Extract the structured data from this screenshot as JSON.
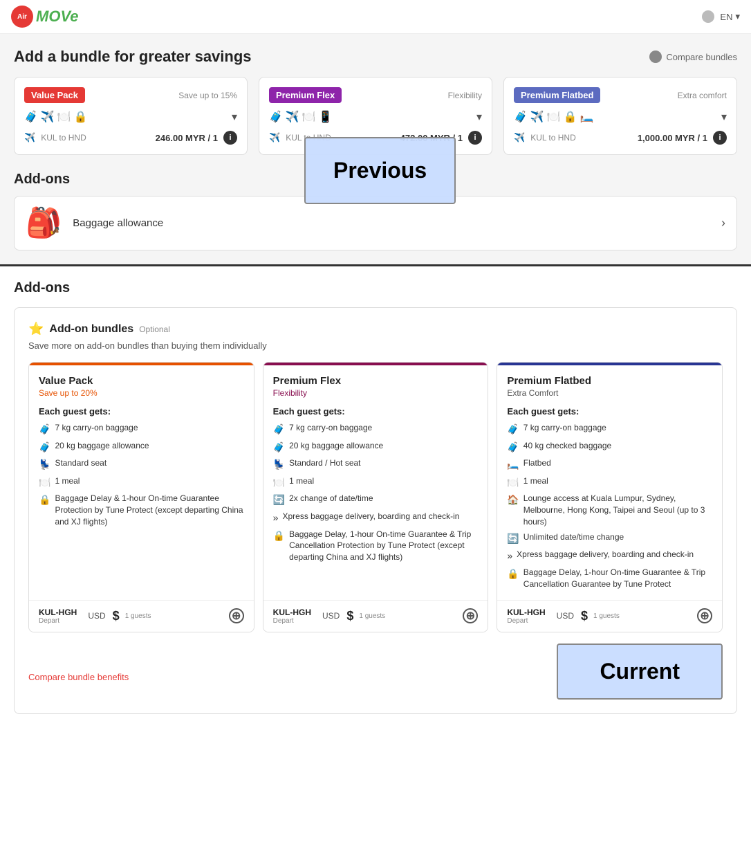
{
  "nav": {
    "logo_text": "MOVe",
    "logo_abbr": "Air",
    "language": "EN"
  },
  "top_section": {
    "title": "Add a bundle for greater savings",
    "compare_label": "Compare bundles",
    "bundles": [
      {
        "tag": "Value Pack",
        "tag_class": "value",
        "subtitle": "Save up to 15%",
        "icons": "🧳✈️🍽️🔒",
        "route": "KUL to HND",
        "price": "246.00 MYR / 1",
        "stripe_class": "stripe-orange"
      },
      {
        "tag": "Premium Flex",
        "tag_class": "premium-flex",
        "subtitle": "Flexibility",
        "icons": "🧳✈️🍽️📱",
        "route": "KUL to HND",
        "price": "472.00 MYR / 1",
        "stripe_class": "stripe-purple"
      },
      {
        "tag": "Premium Flatbed",
        "tag_class": "premium-flatbed",
        "subtitle": "Extra comfort",
        "icons": "🧳✈️🍽️🔒🛏️",
        "route": "KUL to HND",
        "price": "1,000.00 MYR / 1",
        "stripe_class": "stripe-indigo"
      }
    ],
    "addons_title": "Add-ons",
    "baggage_label": "Baggage allowance",
    "previous_label": "Previous"
  },
  "bottom_section": {
    "title": "Add-ons",
    "bundles_section": {
      "title": "Add-on bundles",
      "optional": "Optional",
      "description": "Save more on add-on bundles than buying them individually",
      "cards": [
        {
          "stripe_class": "stripe-orange",
          "title": "Value Pack",
          "subtitle": "Save up to 20%",
          "subtitle_class": "card-subtitle",
          "each_guest": "Each guest gets:",
          "features": [
            {
              "icon": "🧳",
              "text": "7 kg carry-on baggage"
            },
            {
              "icon": "🧳",
              "text": "20 kg baggage allowance"
            },
            {
              "icon": "💺",
              "text": "Standard seat"
            },
            {
              "icon": "🍽️",
              "text": "1 meal"
            },
            {
              "icon": "🔒",
              "text": "Baggage Delay & 1-hour On-time Guarantee Protection by Tune Protect (except departing China and XJ flights)"
            }
          ],
          "footer": {
            "route": "KUL-HGH",
            "sub": "Depart",
            "currency": "USD",
            "price": "$",
            "guests": "1 guests"
          }
        },
        {
          "stripe_class": "stripe-purple",
          "title": "Premium Flex",
          "subtitle": "Flexibility",
          "subtitle_class": "card-subtitle flex-color",
          "each_guest": "Each guest gets:",
          "features": [
            {
              "icon": "🧳",
              "text": "7 kg carry-on baggage"
            },
            {
              "icon": "🧳",
              "text": "20 kg baggage allowance"
            },
            {
              "icon": "💺",
              "text": "Standard / Hot seat"
            },
            {
              "icon": "🍽️",
              "text": "1 meal"
            },
            {
              "icon": "🔄",
              "text": "2x change of date/time"
            },
            {
              "icon": "»",
              "text": "Xpress baggage delivery, boarding and check-in"
            },
            {
              "icon": "🔒",
              "text": "Baggage Delay, 1-hour On-time Guarantee & Trip Cancellation Protection by Tune Protect (except departing China and XJ flights)"
            }
          ],
          "footer": {
            "route": "KUL-HGH",
            "sub": "Depart",
            "currency": "USD",
            "price": "$",
            "guests": "1 guests"
          }
        },
        {
          "stripe_class": "stripe-indigo",
          "title": "Premium Flatbed",
          "subtitle": "Extra Comfort",
          "subtitle_class": "card-subtitle flatbed-color",
          "each_guest": "Each guest gets:",
          "features": [
            {
              "icon": "🧳",
              "text": "7 kg carry-on baggage"
            },
            {
              "icon": "🧳",
              "text": "40 kg checked baggage"
            },
            {
              "icon": "🛏️",
              "text": "Flatbed"
            },
            {
              "icon": "🍽️",
              "text": "1 meal"
            },
            {
              "icon": "🏠",
              "text": "Lounge access at Kuala Lumpur, Sydney, Melbourne, Hong Kong, Taipei and Seoul (up to 3 hours)"
            },
            {
              "icon": "🔄",
              "text": "Unlimited date/time change"
            },
            {
              "icon": "»",
              "text": "Xpress baggage delivery, boarding and check-in"
            },
            {
              "icon": "🔒",
              "text": "Baggage Delay, 1-hour On-time Guarantee & Trip Cancellation Guarantee by Tune Protect"
            }
          ],
          "footer": {
            "route": "KUL-HGH",
            "sub": "Depart",
            "currency": "USD",
            "price": "$",
            "guests": "1 guests"
          }
        }
      ],
      "compare_link": "Compare bundle benefits",
      "current_label": "Current"
    }
  }
}
